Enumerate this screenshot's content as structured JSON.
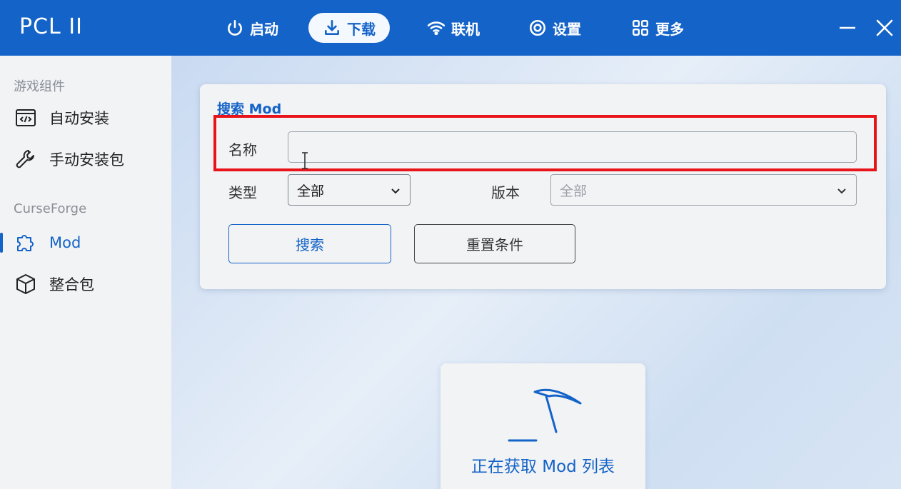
{
  "app": {
    "title": "PCL II"
  },
  "nav": {
    "launch": "启动",
    "download": "下载",
    "online": "联机",
    "settings": "设置",
    "more": "更多"
  },
  "sidebar": {
    "section_game": "游戏组件",
    "auto_install": "自动安装",
    "manual_install": "手动安装包",
    "section_curseforge": "CurseForge",
    "mod": "Mod",
    "modpack": "整合包"
  },
  "search_card": {
    "title": "搜索 Mod",
    "name_label": "名称",
    "name_value": "",
    "type_label": "类型",
    "type_value": "全部",
    "version_label": "版本",
    "version_value": "全部",
    "search_button": "搜索",
    "reset_button": "重置条件"
  },
  "loading": {
    "text": "正在获取 Mod 列表"
  },
  "colors": {
    "accent": "#1463c8",
    "highlight": "#e8141a"
  }
}
